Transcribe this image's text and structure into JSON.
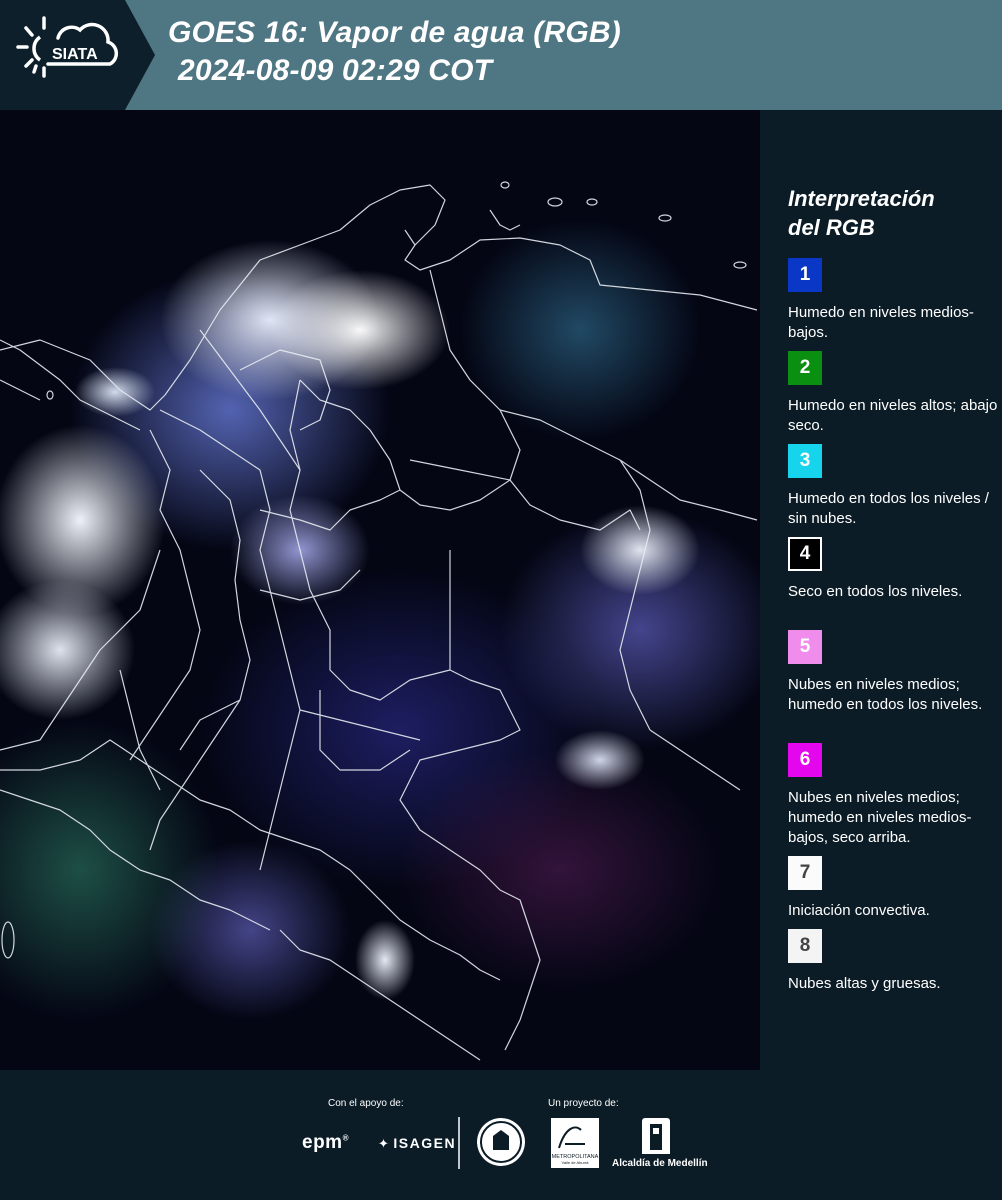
{
  "header": {
    "logo_text": "SIATA",
    "title_line1": "GOES 16: Vapor de agua (RGB)",
    "title_line2": "2024-08-09 02:29 COT",
    "logo_icon": "sun-cloud-icon"
  },
  "legend": {
    "title_line1": "Interpretación",
    "title_line2": "del RGB",
    "items": [
      {
        "num": "1",
        "color": "#0b37c6",
        "text_color": "#ffffff",
        "border": "#0b37c6",
        "text": "Humedo en niveles medios-bajos."
      },
      {
        "num": "2",
        "color": "#0b8f10",
        "text_color": "#ffffff",
        "border": "#0b8f10",
        "text": "Humedo en niveles altos; abajo seco."
      },
      {
        "num": "3",
        "color": "#16d4ec",
        "text_color": "#ffffff",
        "border": "#16d4ec",
        "text": "Humedo en todos los niveles / sin nubes."
      },
      {
        "num": "4",
        "color": "#000000",
        "text_color": "#ffffff",
        "border": "#ffffff",
        "text": "Seco en todos los niveles."
      },
      {
        "num": "5",
        "color": "#f08cec",
        "text_color": "#ffffff",
        "border": "#f08cec",
        "text": "Nubes en niveles medios; humedo en todos los niveles."
      },
      {
        "num": "6",
        "color": "#e406ec",
        "text_color": "#ffffff",
        "border": "#e406ec",
        "text": "Nubes en niveles medios; humedo en niveles medios-bajos, seco arriba."
      },
      {
        "num": "7",
        "color": "#fbfbfb",
        "text_color": "#444444",
        "border": "#fbfbfb",
        "text": "Iniciación convectiva."
      },
      {
        "num": "8",
        "color": "#f4f4f4",
        "text_color": "#444444",
        "border": "#f4f4f4",
        "text": "Nubes altas y gruesas."
      }
    ]
  },
  "footer": {
    "support_label": "Con el apoyo de:",
    "project_label": "Un proyecto de:",
    "sponsor1": "epm",
    "sponsor1_mark": "®",
    "sponsor2": "ISAGEN",
    "org1_icon": "city-seal-icon",
    "org2": "METROPOLITANA",
    "org2_sub": "Valle de Aburrá",
    "org2_icon": "area-metropolitana-logo",
    "org3": "Alcaldía de Medellín",
    "org3_icon": "alcaldia-tower-icon"
  }
}
